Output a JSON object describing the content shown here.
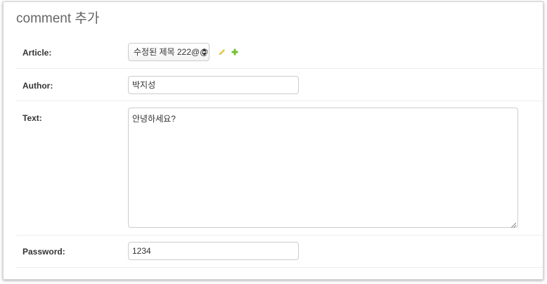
{
  "page": {
    "title": "comment 추가"
  },
  "form": {
    "article": {
      "label": "Article:",
      "selected": "수정된 제목 222@@",
      "arrows_icon": "select-arrows-icon",
      "edit_icon": "pencil-icon",
      "add_icon": "plus-icon",
      "edit_color": "#e3c73f",
      "add_color": "#70bf2b"
    },
    "author": {
      "label": "Author:",
      "value": "박지성"
    },
    "text": {
      "label": "Text:",
      "value": "안녕하세요?"
    },
    "password": {
      "label": "Password:",
      "value": "1234"
    }
  }
}
